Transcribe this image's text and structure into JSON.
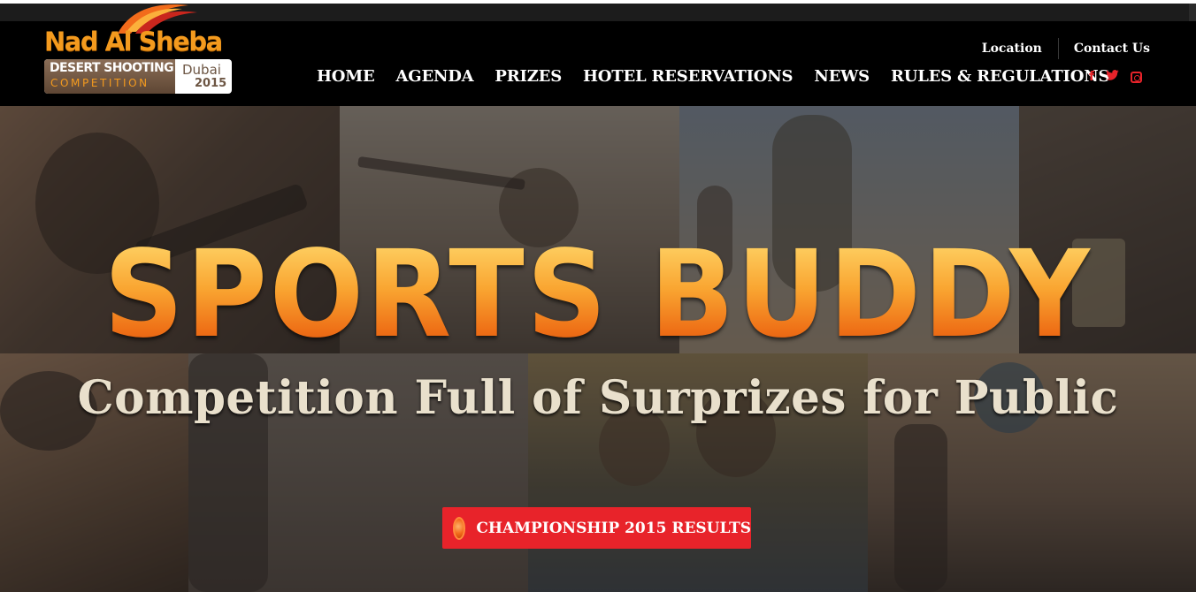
{
  "brand": {
    "name": "Nad Al Sheba",
    "badge_line1": "DESERT SHOOTING",
    "badge_line2": "COMPETITION",
    "city": "Dubai",
    "year": "2015",
    "primary_color": "#f39a1e",
    "secondary_color": "#6d5644"
  },
  "utility_nav": {
    "location": "Location",
    "contact": "Contact Us"
  },
  "main_nav": {
    "items": [
      "HOME",
      "AGENDA",
      "PRIZES",
      "HOTEL RESERVATIONS",
      "NEWS",
      "RULES & REGULATIONS"
    ]
  },
  "social": {
    "facebook_glyph": "f",
    "twitter_glyph": "🐦",
    "icons": [
      "facebook-icon",
      "twitter-icon",
      "instagram-icon"
    ],
    "color": "#e8232a"
  },
  "hero": {
    "headline": "SPORTS BUDDY",
    "subheadline": "Competition Full of Surprizes for Public",
    "cta_label": "CHAMPIONSHIP 2015 RESULTS",
    "cta_color": "#e8232a"
  }
}
